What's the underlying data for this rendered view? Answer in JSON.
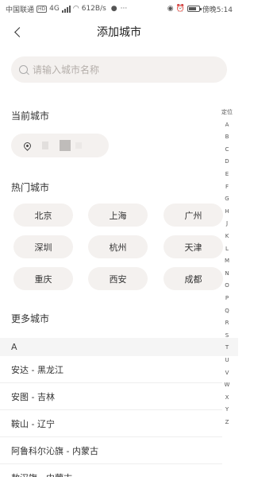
{
  "status_bar": {
    "carrier": "中国联通",
    "hd": "HD",
    "net": "4G",
    "speed": "612B/s",
    "time": "傍晚5:14",
    "battery_level": 0.75
  },
  "header": {
    "title": "添加城市"
  },
  "search": {
    "placeholder": "请输入城市名称"
  },
  "current": {
    "title": "当前城市"
  },
  "hot": {
    "title": "热门城市",
    "cities": [
      "北京",
      "上海",
      "广州",
      "深圳",
      "杭州",
      "天津",
      "重庆",
      "西安",
      "成都"
    ]
  },
  "more": {
    "title": "更多城市",
    "letter": "A",
    "cities": [
      "安达 - 黑龙江",
      "安图 - 吉林",
      "鞍山 - 辽宁",
      "阿鲁科尔沁旗 - 内蒙古",
      "敖汉旗 - 内蒙古"
    ]
  },
  "index": [
    "定位",
    "A",
    "B",
    "C",
    "D",
    "E",
    "F",
    "G",
    "H",
    "J",
    "K",
    "L",
    "M",
    "N",
    "O",
    "P",
    "Q",
    "R",
    "S",
    "T",
    "U",
    "V",
    "W",
    "X",
    "Y",
    "Z"
  ]
}
